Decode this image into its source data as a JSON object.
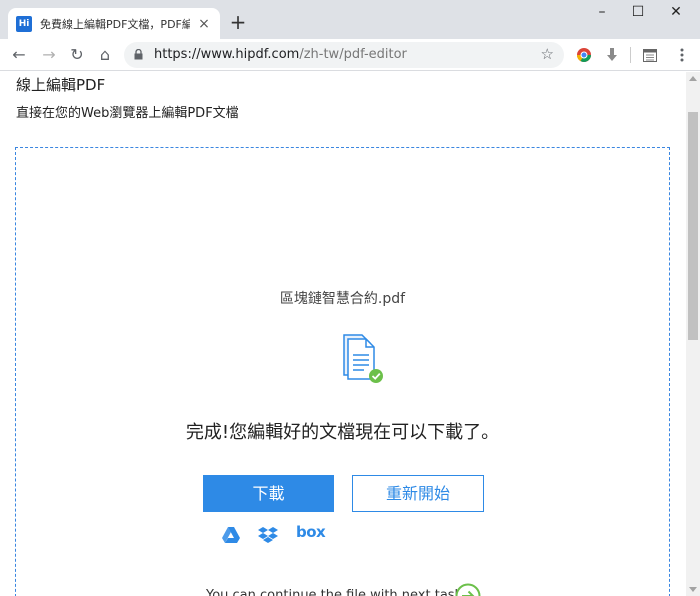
{
  "browser": {
    "tab_title": "免費線上編輯PDF文檔，PDF編輯",
    "favicon_text": "Hi",
    "tab_close": "×",
    "new_tab": "+",
    "window_controls": {
      "minimize": "–",
      "maximize": "☐",
      "close": "✕"
    },
    "nav": {
      "back": "←",
      "forward": "→",
      "reload": "↻",
      "home": "⌂"
    },
    "url_host": "https://www.hipdf.com",
    "url_path": "/zh-tw/pdf-editor",
    "star": "☆"
  },
  "page": {
    "title": "線上編輯PDF",
    "subtitle": "直接在您的Web瀏覽器上編輯PDF文檔",
    "filename": "區塊鏈智慧合約.pdf",
    "done_message": "完成!您編輯好的文檔現在可以下載了。",
    "download_label": "下載",
    "restart_label": "重新開始",
    "box_label": "box",
    "continue_text": "You can continue the file with next task"
  },
  "colors": {
    "accent": "#2e8ae6",
    "success": "#6cc04a"
  }
}
